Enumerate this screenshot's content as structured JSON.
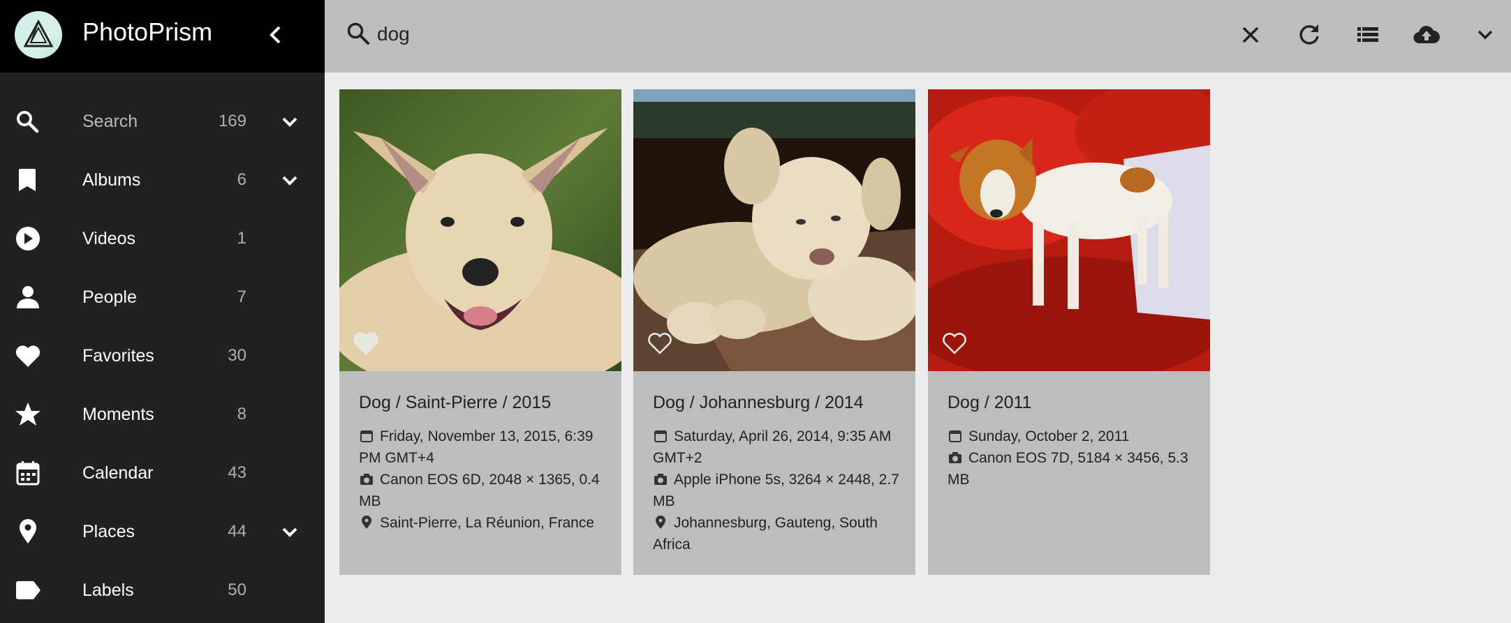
{
  "app": {
    "title": "PhotoPrism"
  },
  "sidebar": {
    "items": [
      {
        "label": "Search",
        "count": "169",
        "icon": "search-icon",
        "expandable": true
      },
      {
        "label": "Albums",
        "count": "6",
        "icon": "bookmark-icon",
        "expandable": true
      },
      {
        "label": "Videos",
        "count": "1",
        "icon": "play-circle-icon",
        "expandable": false
      },
      {
        "label": "People",
        "count": "7",
        "icon": "person-icon",
        "expandable": false
      },
      {
        "label": "Favorites",
        "count": "30",
        "icon": "heart-icon",
        "expandable": false
      },
      {
        "label": "Moments",
        "count": "8",
        "icon": "star-icon",
        "expandable": false
      },
      {
        "label": "Calendar",
        "count": "43",
        "icon": "calendar-icon",
        "expandable": false
      },
      {
        "label": "Places",
        "count": "44",
        "icon": "map-marker-icon",
        "expandable": true
      },
      {
        "label": "Labels",
        "count": "50",
        "icon": "label-icon",
        "expandable": false
      }
    ]
  },
  "search": {
    "value": "dog"
  },
  "toolbar": {
    "icons": [
      "close-icon",
      "refresh-icon",
      "list-view-icon",
      "cloud-upload-icon",
      "chevron-down-icon"
    ]
  },
  "photos": [
    {
      "title": "Dog / Saint-Pierre / 2015",
      "date": "Friday, November 13, 2015, 6:39 PM GMT+4",
      "camera": "Canon EOS 6D, 2048 × 1365, 0.4 MB",
      "location": "Saint-Pierre, La Réunion, France",
      "favorite": true
    },
    {
      "title": "Dog / Johannesburg / 2014",
      "date": "Saturday, April 26, 2014, 9:35 AM GMT+2",
      "camera": "Apple iPhone 5s, 3264 × 2448, 2.7 MB",
      "location": "Johannesburg, Gauteng, South Africa",
      "favorite": false
    },
    {
      "title": "Dog / 2011",
      "date": "Sunday, October 2, 2011",
      "camera": "Canon EOS 7D, 5184 × 3456, 5.3 MB",
      "location": "",
      "favorite": false
    }
  ],
  "colors": {
    "sidebar": "#212121",
    "brand_bar": "#000000",
    "topbar": "#bdbdbd",
    "card": "#bdbdbd",
    "page": "#ededed"
  }
}
